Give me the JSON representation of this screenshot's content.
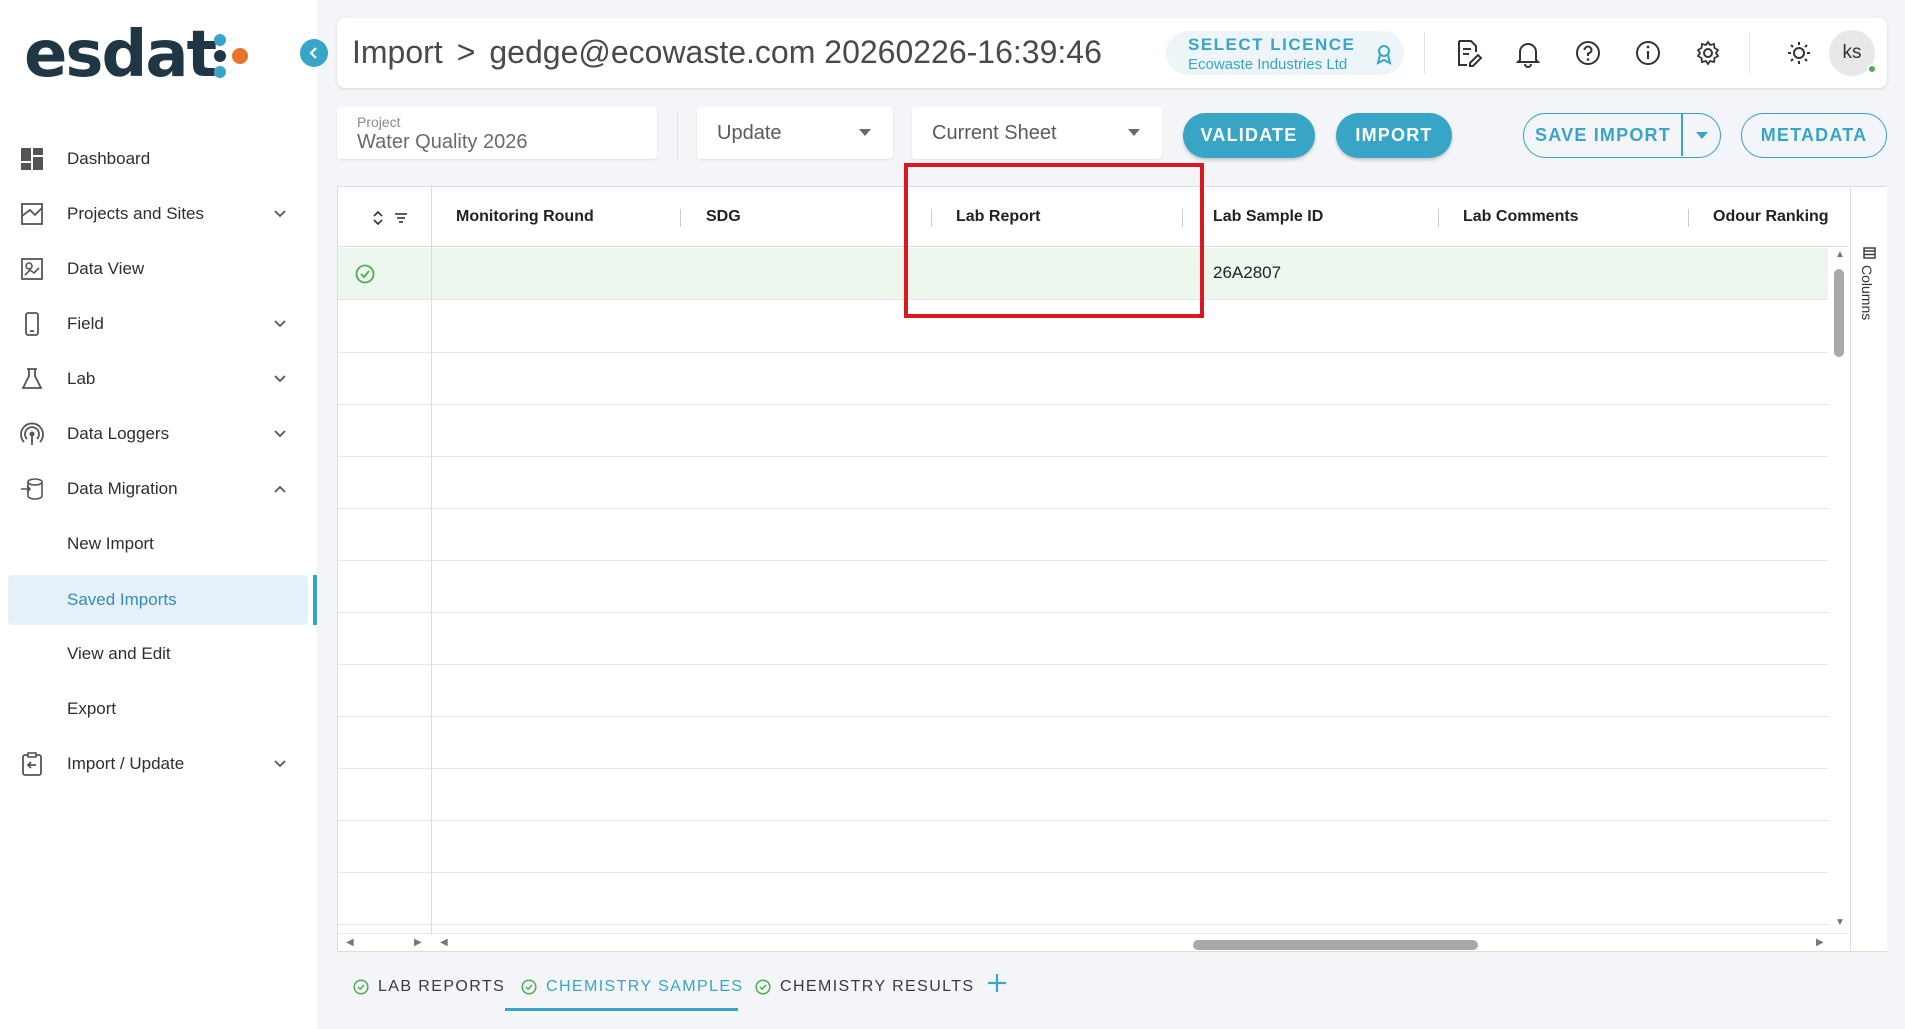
{
  "brand": {
    "logo_text": "esdat"
  },
  "sidebar": {
    "items": [
      {
        "label": "Dashboard"
      },
      {
        "label": "Projects and Sites"
      },
      {
        "label": "Data View"
      },
      {
        "label": "Field"
      },
      {
        "label": "Lab"
      },
      {
        "label": "Data Loggers"
      },
      {
        "label": "Data Migration"
      },
      {
        "label": "New Import"
      },
      {
        "label": "Saved Imports"
      },
      {
        "label": "View and Edit"
      },
      {
        "label": "Export"
      },
      {
        "label": "Import / Update"
      }
    ],
    "active": "Saved Imports"
  },
  "header": {
    "title": "Import",
    "separator": ">",
    "subtitle": "gedge@ecowaste.com 20260226-16:39:46",
    "licence_title": "SELECT LICENCE",
    "licence_sub": "Ecowaste Industries Ltd",
    "avatar": "ks"
  },
  "toolbar": {
    "project_label": "Project",
    "project_value": "Water Quality 2026",
    "mode": "Update",
    "sheet": "Current Sheet",
    "validate": "VALIDATE",
    "import": "IMPORT",
    "save_import": "SAVE IMPORT",
    "metadata": "METADATA"
  },
  "grid": {
    "columns": [
      "Monitoring Round",
      "SDG",
      "Lab Report",
      "Lab Sample ID",
      "Lab Comments",
      "Odour Ranking"
    ],
    "rows": [
      {
        "lab_sample_id": "26A2807",
        "status": "valid"
      }
    ],
    "side_panel": "Columns"
  },
  "tabs": [
    {
      "label": "LAB REPORTS"
    },
    {
      "label": "CHEMISTRY SAMPLES"
    },
    {
      "label": "CHEMISTRY RESULTS"
    }
  ],
  "colors": {
    "accent": "#38a5c6",
    "highlight": "#d71920",
    "valid": "#4caf50"
  }
}
